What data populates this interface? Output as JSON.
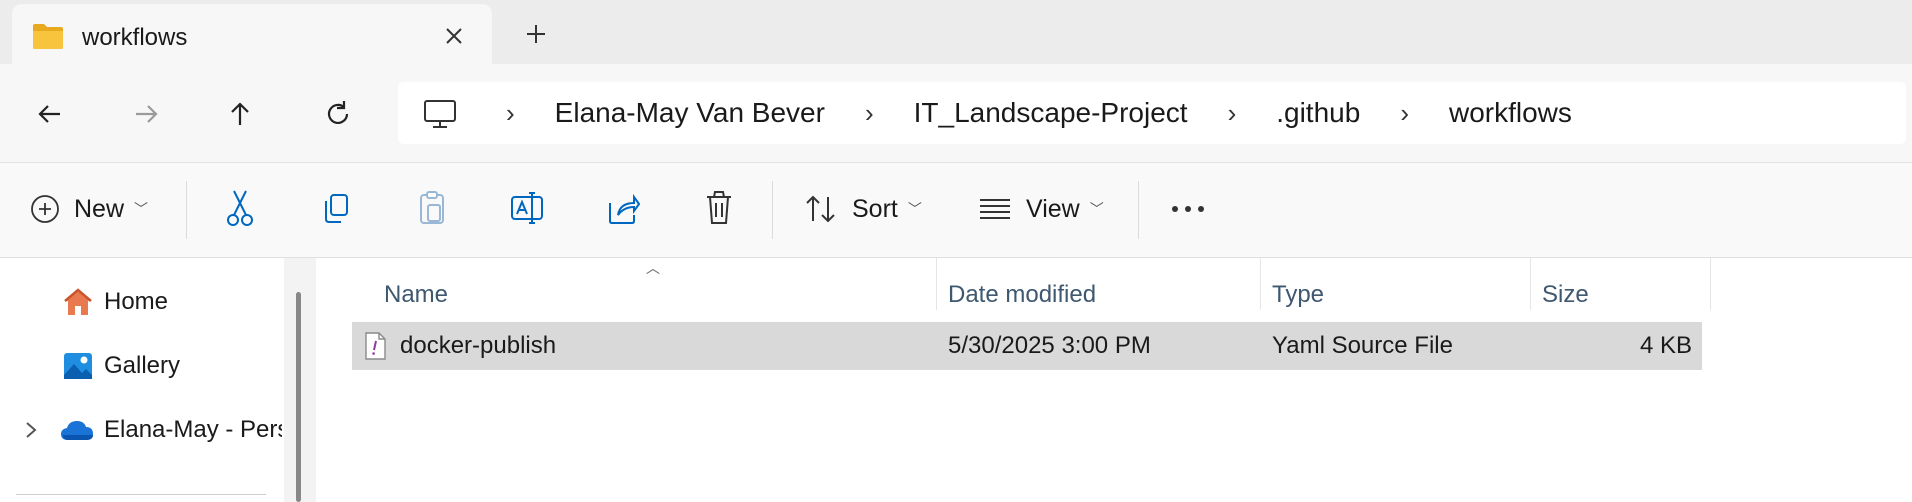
{
  "tab": {
    "title": "workflows"
  },
  "address": {
    "crumbs": [
      "Elana-May Van Bever",
      "IT_Landscape-Project",
      ".github",
      "workflows"
    ]
  },
  "toolbar": {
    "new_label": "New",
    "sort_label": "Sort",
    "view_label": "View"
  },
  "sidebar": {
    "items": [
      {
        "label": "Home"
      },
      {
        "label": "Gallery"
      },
      {
        "label": "Elana-May - Personal"
      }
    ]
  },
  "columns": {
    "name": "Name",
    "date": "Date modified",
    "type": "Type",
    "size": "Size"
  },
  "files": [
    {
      "name": "docker-publish",
      "date": "5/30/2025 3:00 PM",
      "type": "Yaml Source File",
      "size": "4 KB",
      "selected": true
    }
  ],
  "colors": {
    "accent": "#0067c0",
    "selection": "#d9d9d9",
    "folder": "#f8c43d"
  }
}
